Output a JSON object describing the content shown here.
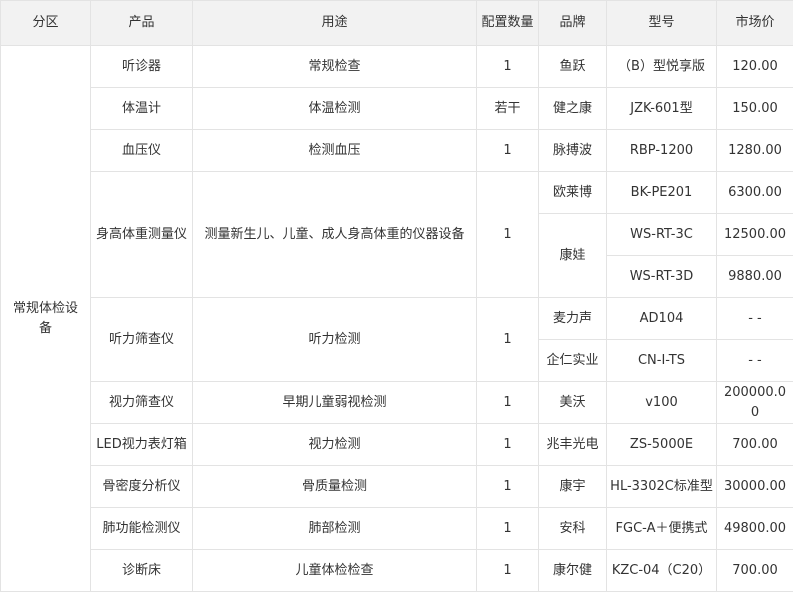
{
  "columns": [
    "分区",
    "产品",
    "用途",
    "配置数量",
    "品牌",
    "型号",
    "市场价"
  ],
  "zone": "常规体检设备",
  "rows": [
    {
      "product": "听诊器",
      "usage": "常规检查",
      "qty": "1",
      "brand": "鱼跃",
      "model": "（B）型悦享版",
      "price": "120.00"
    },
    {
      "product": "体温计",
      "usage": "体温检测",
      "qty": "若干",
      "brand": "健之康",
      "model": "JZK-601型",
      "price": "150.00"
    },
    {
      "product": "血压仪",
      "usage": "检测血压",
      "qty": "1",
      "brand": "脉搏波",
      "model": "RBP-1200",
      "price": "1280.00"
    },
    {
      "product": "身高体重测量仪",
      "usage": "测量新生儿、儿童、成人身高体重的仪器设备",
      "qty": "1",
      "subrows": [
        {
          "brand": "欧莱博",
          "model": "BK-PE201",
          "price": "6300.00"
        },
        {
          "brand": "康娃",
          "model": "WS-RT-3C",
          "price": "12500.00"
        },
        {
          "model": "WS-RT-3D",
          "price": "9880.00"
        }
      ]
    },
    {
      "product": "听力筛查仪",
      "usage": "听力检测",
      "qty": "1",
      "subrows": [
        {
          "brand": "麦力声",
          "model": "AD104",
          "price": "- -"
        },
        {
          "brand": "企仁实业",
          "model": "CN-I-TS",
          "price": "- -"
        }
      ]
    },
    {
      "product": "视力筛查仪",
      "usage": "早期儿童弱视检测",
      "qty": "1",
      "brand": "美沃",
      "model": "v100",
      "price": "200000.00"
    },
    {
      "product": "LED视力表灯箱",
      "usage": "视力检测",
      "qty": "1",
      "brand": "兆丰光电",
      "model": "ZS-5000E",
      "price": "700.00"
    },
    {
      "product": "骨密度分析仪",
      "usage": "骨质量检测",
      "qty": "1",
      "brand": "康宇",
      "model": "HL-3302C标准型",
      "price": "30000.00"
    },
    {
      "product": "肺功能检测仪",
      "usage": "肺部检测",
      "qty": "1",
      "brand": "安科",
      "model": "FGC-A＋便携式",
      "price": "49800.00"
    },
    {
      "product": "诊断床",
      "usage": "儿童体检检查",
      "qty": "1",
      "brand": "康尔健",
      "model": "KZC-04（C20）",
      "price": "700.00"
    }
  ]
}
